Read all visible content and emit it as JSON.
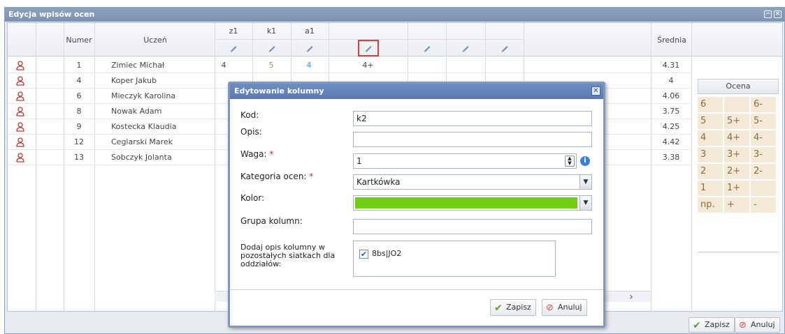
{
  "window": {
    "title": "Edycja wpisów ocen"
  },
  "grid": {
    "headers": {
      "numer": "Numer",
      "uczen": "Uczeń",
      "srednia": "Średnia",
      "grade_cols": [
        "z1",
        "k1",
        "a1",
        "",
        "",
        "",
        ""
      ]
    },
    "rows": [
      {
        "numer": "1",
        "uczen": "Zimiec Michał",
        "z1": "4",
        "k1": "5",
        "a1": "4",
        "c4": "4+",
        "srednia": "4.31"
      },
      {
        "numer": "4",
        "uczen": "Koper Jakub",
        "srednia": "4"
      },
      {
        "numer": "6",
        "uczen": "Mieczyk Karolina",
        "srednia": "4.06"
      },
      {
        "numer": "8",
        "uczen": "Nowak Adam",
        "srednia": "3.75"
      },
      {
        "numer": "9",
        "uczen": "Kostecka Klaudia",
        "srednia": "4.25"
      },
      {
        "numer": "12",
        "uczen": "Ceglarski Marek",
        "srednia": "4.42"
      },
      {
        "numer": "13",
        "uczen": "Sobczyk Jolanta",
        "srednia": "3.38"
      }
    ]
  },
  "grade_panel": {
    "title": "Ocena",
    "rows": [
      [
        "6",
        "",
        "6-"
      ],
      [
        "5",
        "5+",
        "5-"
      ],
      [
        "4",
        "4+",
        "4-"
      ],
      [
        "3",
        "3+",
        "3-"
      ],
      [
        "2",
        "2+",
        "2-"
      ],
      [
        "1",
        "1+",
        ""
      ],
      [
        "np.",
        "+",
        "-"
      ]
    ]
  },
  "footer": {
    "save_label": "Zapisz",
    "cancel_label": "Anuluj"
  },
  "dialog": {
    "title": "Edytowanie kolumny",
    "kod_label": "Kod:",
    "kod_value": "k2",
    "opis_label": "Opis:",
    "opis_value": "",
    "waga_label": "Waga:",
    "waga_value": "1",
    "kategoria_label": "Kategoria ocen:",
    "kategoria_value": "Kartkówka",
    "kolor_label": "Kolor:",
    "kolor_value": "#6fcf12",
    "grupa_label": "Grupa kolumn:",
    "grupa_value": "",
    "dodaj_label": "Dodaj opis kolumny w pozostałych siatkach dla oddziałów:",
    "dodaj_option": "8bs|JO2",
    "dodaj_checked": true,
    "save_label": "Zapisz",
    "cancel_label": "Anuluj"
  },
  "colors": {
    "k1_grade": "#6ab04c",
    "a1_grade": "#3a9ad9",
    "title_bar": "#7d93b0",
    "dialog_title": "#5a79b0",
    "highlight_border": "#e53935"
  }
}
